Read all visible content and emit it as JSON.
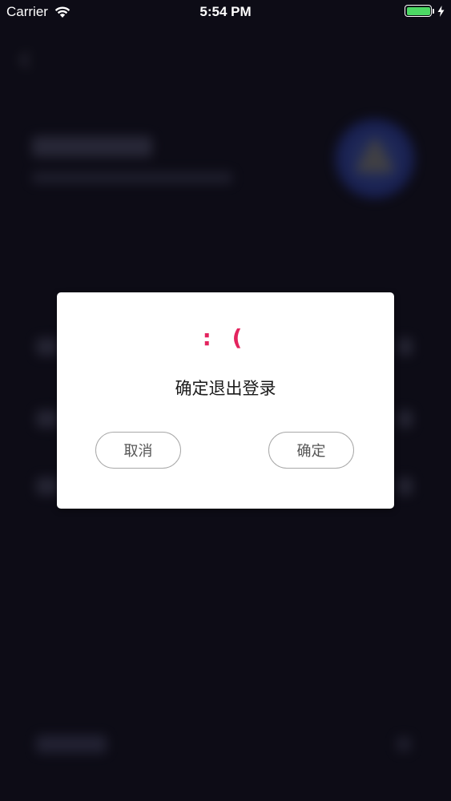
{
  "status_bar": {
    "carrier": "Carrier",
    "time": "5:54 PM",
    "battery_color": "#4cd964",
    "battery_level": 1.0,
    "icons": [
      "wifi-icon",
      "battery-icon",
      "charging-bolt-icon"
    ]
  },
  "dialog": {
    "emoticon": ": (",
    "message": "确定退出登录",
    "cancel_label": "取消",
    "confirm_label": "确定",
    "accent_color": "#e3245e"
  },
  "background": {
    "color": "#0d0c16"
  }
}
